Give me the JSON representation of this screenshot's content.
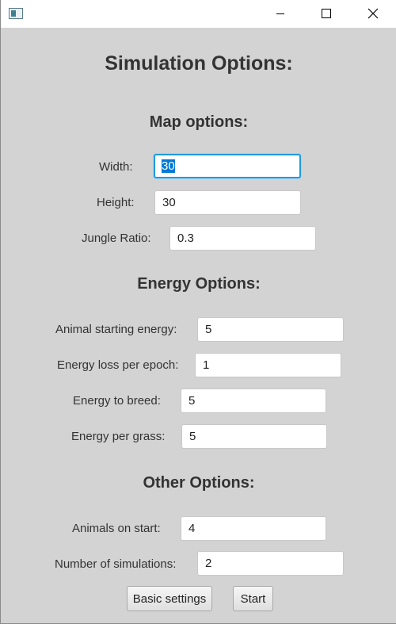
{
  "window": {
    "icon": "java-app-icon",
    "controls": [
      "minimize-icon",
      "maximize-icon",
      "close-icon"
    ]
  },
  "title": "Simulation Options:",
  "map_options": {
    "heading": "Map options:",
    "width": {
      "label": "Width:",
      "value": "30"
    },
    "height": {
      "label": "Height:",
      "value": "30"
    },
    "jungle_ratio": {
      "label": "Jungle Ratio:",
      "value": "0.3"
    }
  },
  "energy_options": {
    "heading": "Energy Options:",
    "starting_energy": {
      "label": "Animal starting energy:",
      "value": "5"
    },
    "energy_loss": {
      "label": "Energy loss per epoch:",
      "value": "1"
    },
    "energy_to_breed": {
      "label": "Energy to breed:",
      "value": "5"
    },
    "energy_per_grass": {
      "label": "Energy per grass:",
      "value": "5"
    }
  },
  "other_options": {
    "heading": "Other Options:",
    "animals_on_start": {
      "label": "Animals on start:",
      "value": "4"
    },
    "num_simulations": {
      "label": "Number of simulations:",
      "value": "2"
    }
  },
  "buttons": {
    "basic_settings": "Basic settings",
    "start": "Start"
  },
  "colors": {
    "background": "#d3d3d3",
    "focus_ring": "#1e9ae0",
    "text": "#333333"
  }
}
